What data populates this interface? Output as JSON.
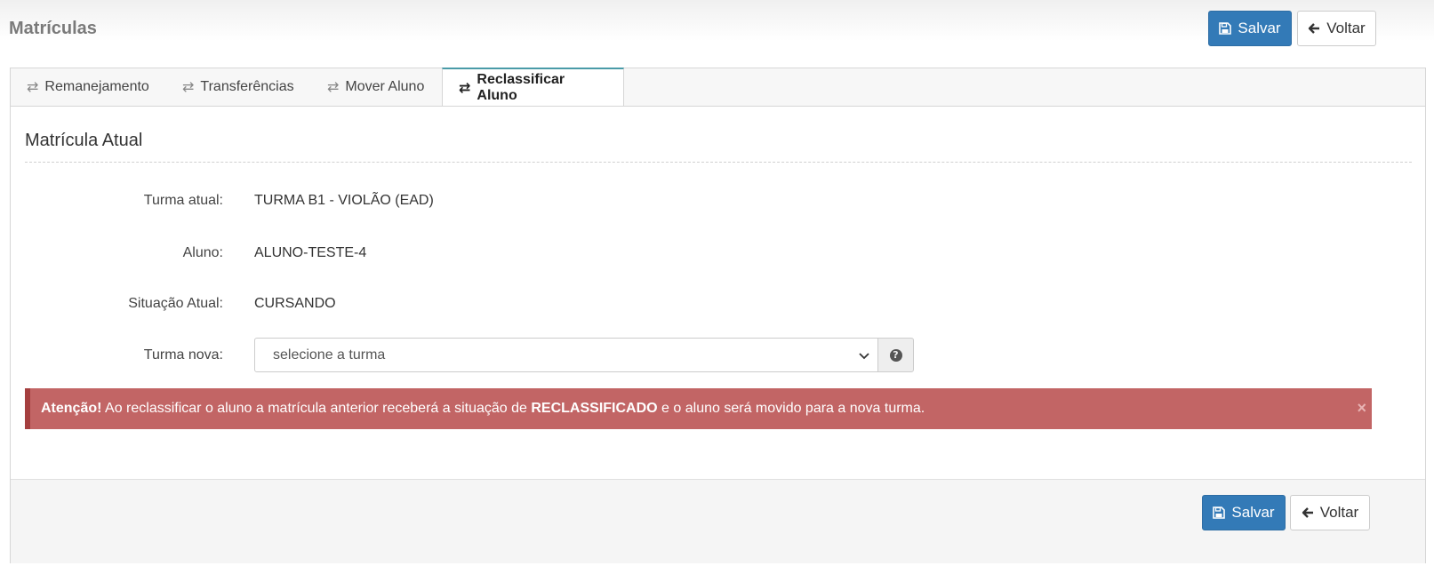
{
  "header": {
    "title": "Matrículas",
    "save_label": "Salvar",
    "back_label": "Voltar"
  },
  "tabs": [
    {
      "label": "Remanejamento",
      "icon": "exchange-icon"
    },
    {
      "label": "Transferências",
      "icon": "exchange-icon"
    },
    {
      "label": "Mover Aluno",
      "icon": "exchange-icon"
    },
    {
      "label": "Reclassificar Aluno",
      "icon": "exchange-icon",
      "active": true
    }
  ],
  "section": {
    "title": "Matrícula Atual"
  },
  "fields": {
    "turma_atual": {
      "label": "Turma atual:",
      "value": "TURMA B1 - VIOLÃO (EAD)"
    },
    "aluno": {
      "label": "Aluno:",
      "value": "ALUNO-TESTE-4"
    },
    "situacao_atual": {
      "label": "Situação Atual:",
      "value": "CURSANDO"
    },
    "turma_nova": {
      "label": "Turma nova:",
      "placeholder": "selecione a turma"
    }
  },
  "alert": {
    "strong": "Atenção!",
    "text_before": " Ao reclassificar o aluno a matrícula anterior receberá a situação de ",
    "emphasis": "RECLASSIFICADO",
    "text_after": " e o aluno será movido para a nova turma.",
    "close": "×"
  },
  "footer": {
    "save_label": "Salvar",
    "back_label": "Voltar"
  },
  "colors": {
    "primary": "#337ab7",
    "danger_bg": "#c26565",
    "tab_accent": "#4a9ba8"
  }
}
